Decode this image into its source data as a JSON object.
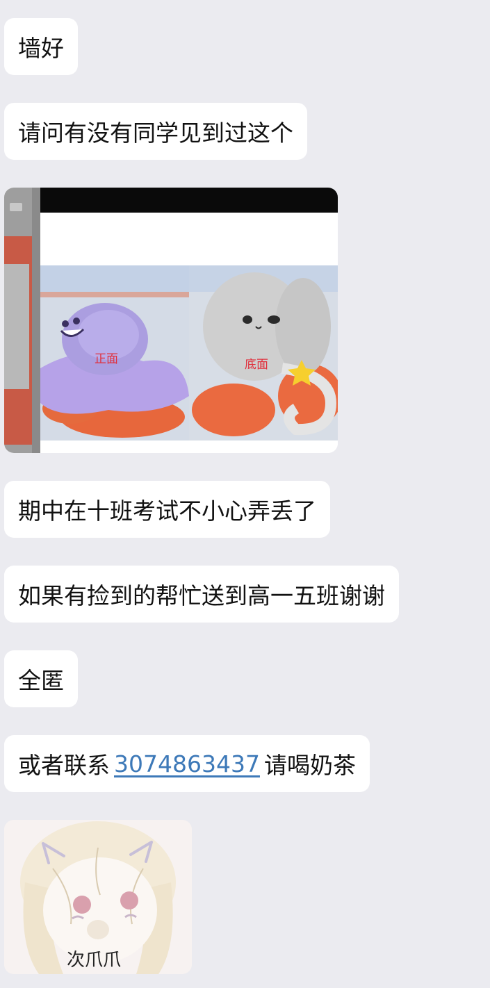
{
  "messages": [
    {
      "text": "墙好"
    },
    {
      "text": "请问有没有同学见到过这个"
    },
    {
      "image": {
        "front_label": "正面",
        "bottom_label": "底面"
      }
    },
    {
      "text": "期中在十班考试不小心弄丢了"
    },
    {
      "text": "如果有捡到的帮忙送到高一五班谢谢"
    },
    {
      "text": "全匿"
    },
    {
      "prefix": "或者联系",
      "link": "3074863437",
      "suffix": "请喝奶茶"
    },
    {
      "sticker": {
        "caption": "次爪爪"
      }
    }
  ],
  "colors": {
    "background": "#ebebf0",
    "bubble": "#ffffff",
    "link": "#3d79b8",
    "photo_label": "#e0303c"
  }
}
